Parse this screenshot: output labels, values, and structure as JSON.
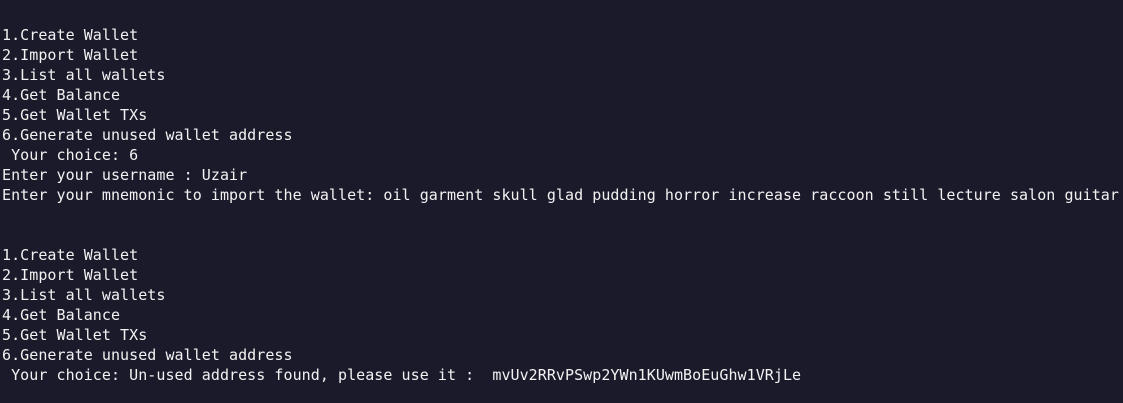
{
  "terminal": {
    "lines": [
      "1.Create Wallet",
      "2.Import Wallet",
      "3.List all wallets",
      "4.Get Balance",
      "5.Get Wallet TXs",
      "6.Generate unused wallet address",
      " Your choice: 6",
      "Enter your username : Uzair",
      "Enter your mnemonic to import the wallet: oil garment skull glad pudding horror increase raccoon still lecture salon guitar",
      "",
      "",
      "1.Create Wallet",
      "2.Import Wallet",
      "3.List all wallets",
      "4.Get Balance",
      "5.Get Wallet TXs",
      "6.Generate unused wallet address",
      " Your choice: Un-used address found, please use it :  mvUv2RRvPSwp2YWn1KUwmBoEuGhw1VRjLe"
    ]
  }
}
